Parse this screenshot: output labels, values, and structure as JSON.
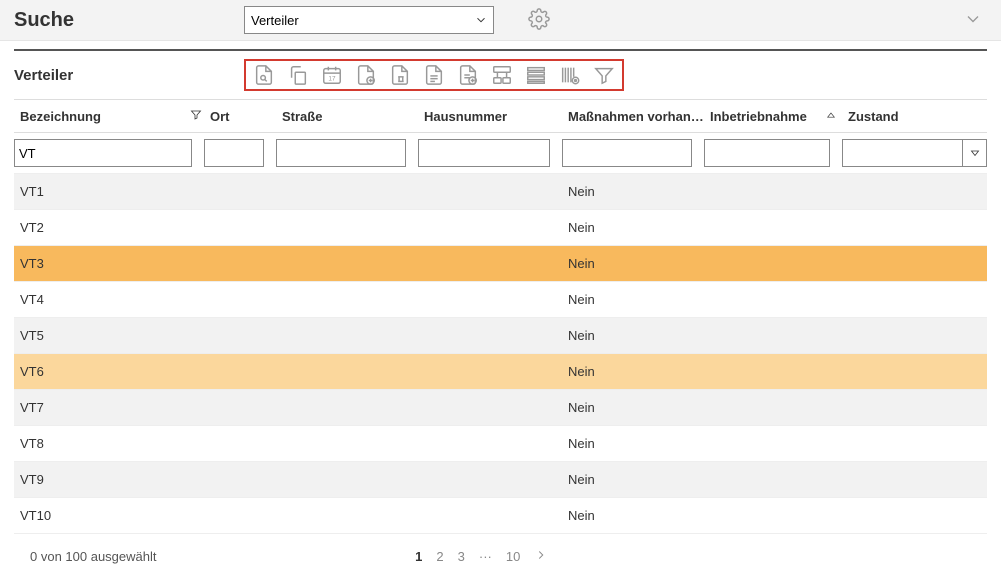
{
  "header": {
    "title": "Suche",
    "dropdown_value": "Verteiler"
  },
  "section": {
    "title": "Verteiler"
  },
  "columns": {
    "bezeichnung": "Bezeichnung",
    "ort": "Ort",
    "strasse": "Straße",
    "hausnummer": "Hausnummer",
    "massnahmen": "Maßnahmen vorhand…",
    "inbetriebnahme": "Inbetriebnahme",
    "zustand": "Zustand"
  },
  "filters": {
    "bezeichnung": "VT",
    "ort": "",
    "strasse": "",
    "hausnummer": "",
    "massnahmen": "",
    "inbetriebnahme": "",
    "zustand": ""
  },
  "rows": [
    {
      "bez": "VT1",
      "mass": "Nein",
      "style": "alt"
    },
    {
      "bez": "VT2",
      "mass": "Nein",
      "style": ""
    },
    {
      "bez": "VT3",
      "mass": "Nein",
      "style": "sel1"
    },
    {
      "bez": "VT4",
      "mass": "Nein",
      "style": ""
    },
    {
      "bez": "VT5",
      "mass": "Nein",
      "style": "alt"
    },
    {
      "bez": "VT6",
      "mass": "Nein",
      "style": "sel2"
    },
    {
      "bez": "VT7",
      "mass": "Nein",
      "style": "alt"
    },
    {
      "bez": "VT8",
      "mass": "Nein",
      "style": ""
    },
    {
      "bez": "VT9",
      "mass": "Nein",
      "style": "alt"
    },
    {
      "bez": "VT10",
      "mass": "Nein",
      "style": ""
    }
  ],
  "footer": {
    "selection": "0 von 100 ausgewählt",
    "pages": [
      "1",
      "2",
      "3",
      "···",
      "10"
    ],
    "current_page": "1"
  }
}
